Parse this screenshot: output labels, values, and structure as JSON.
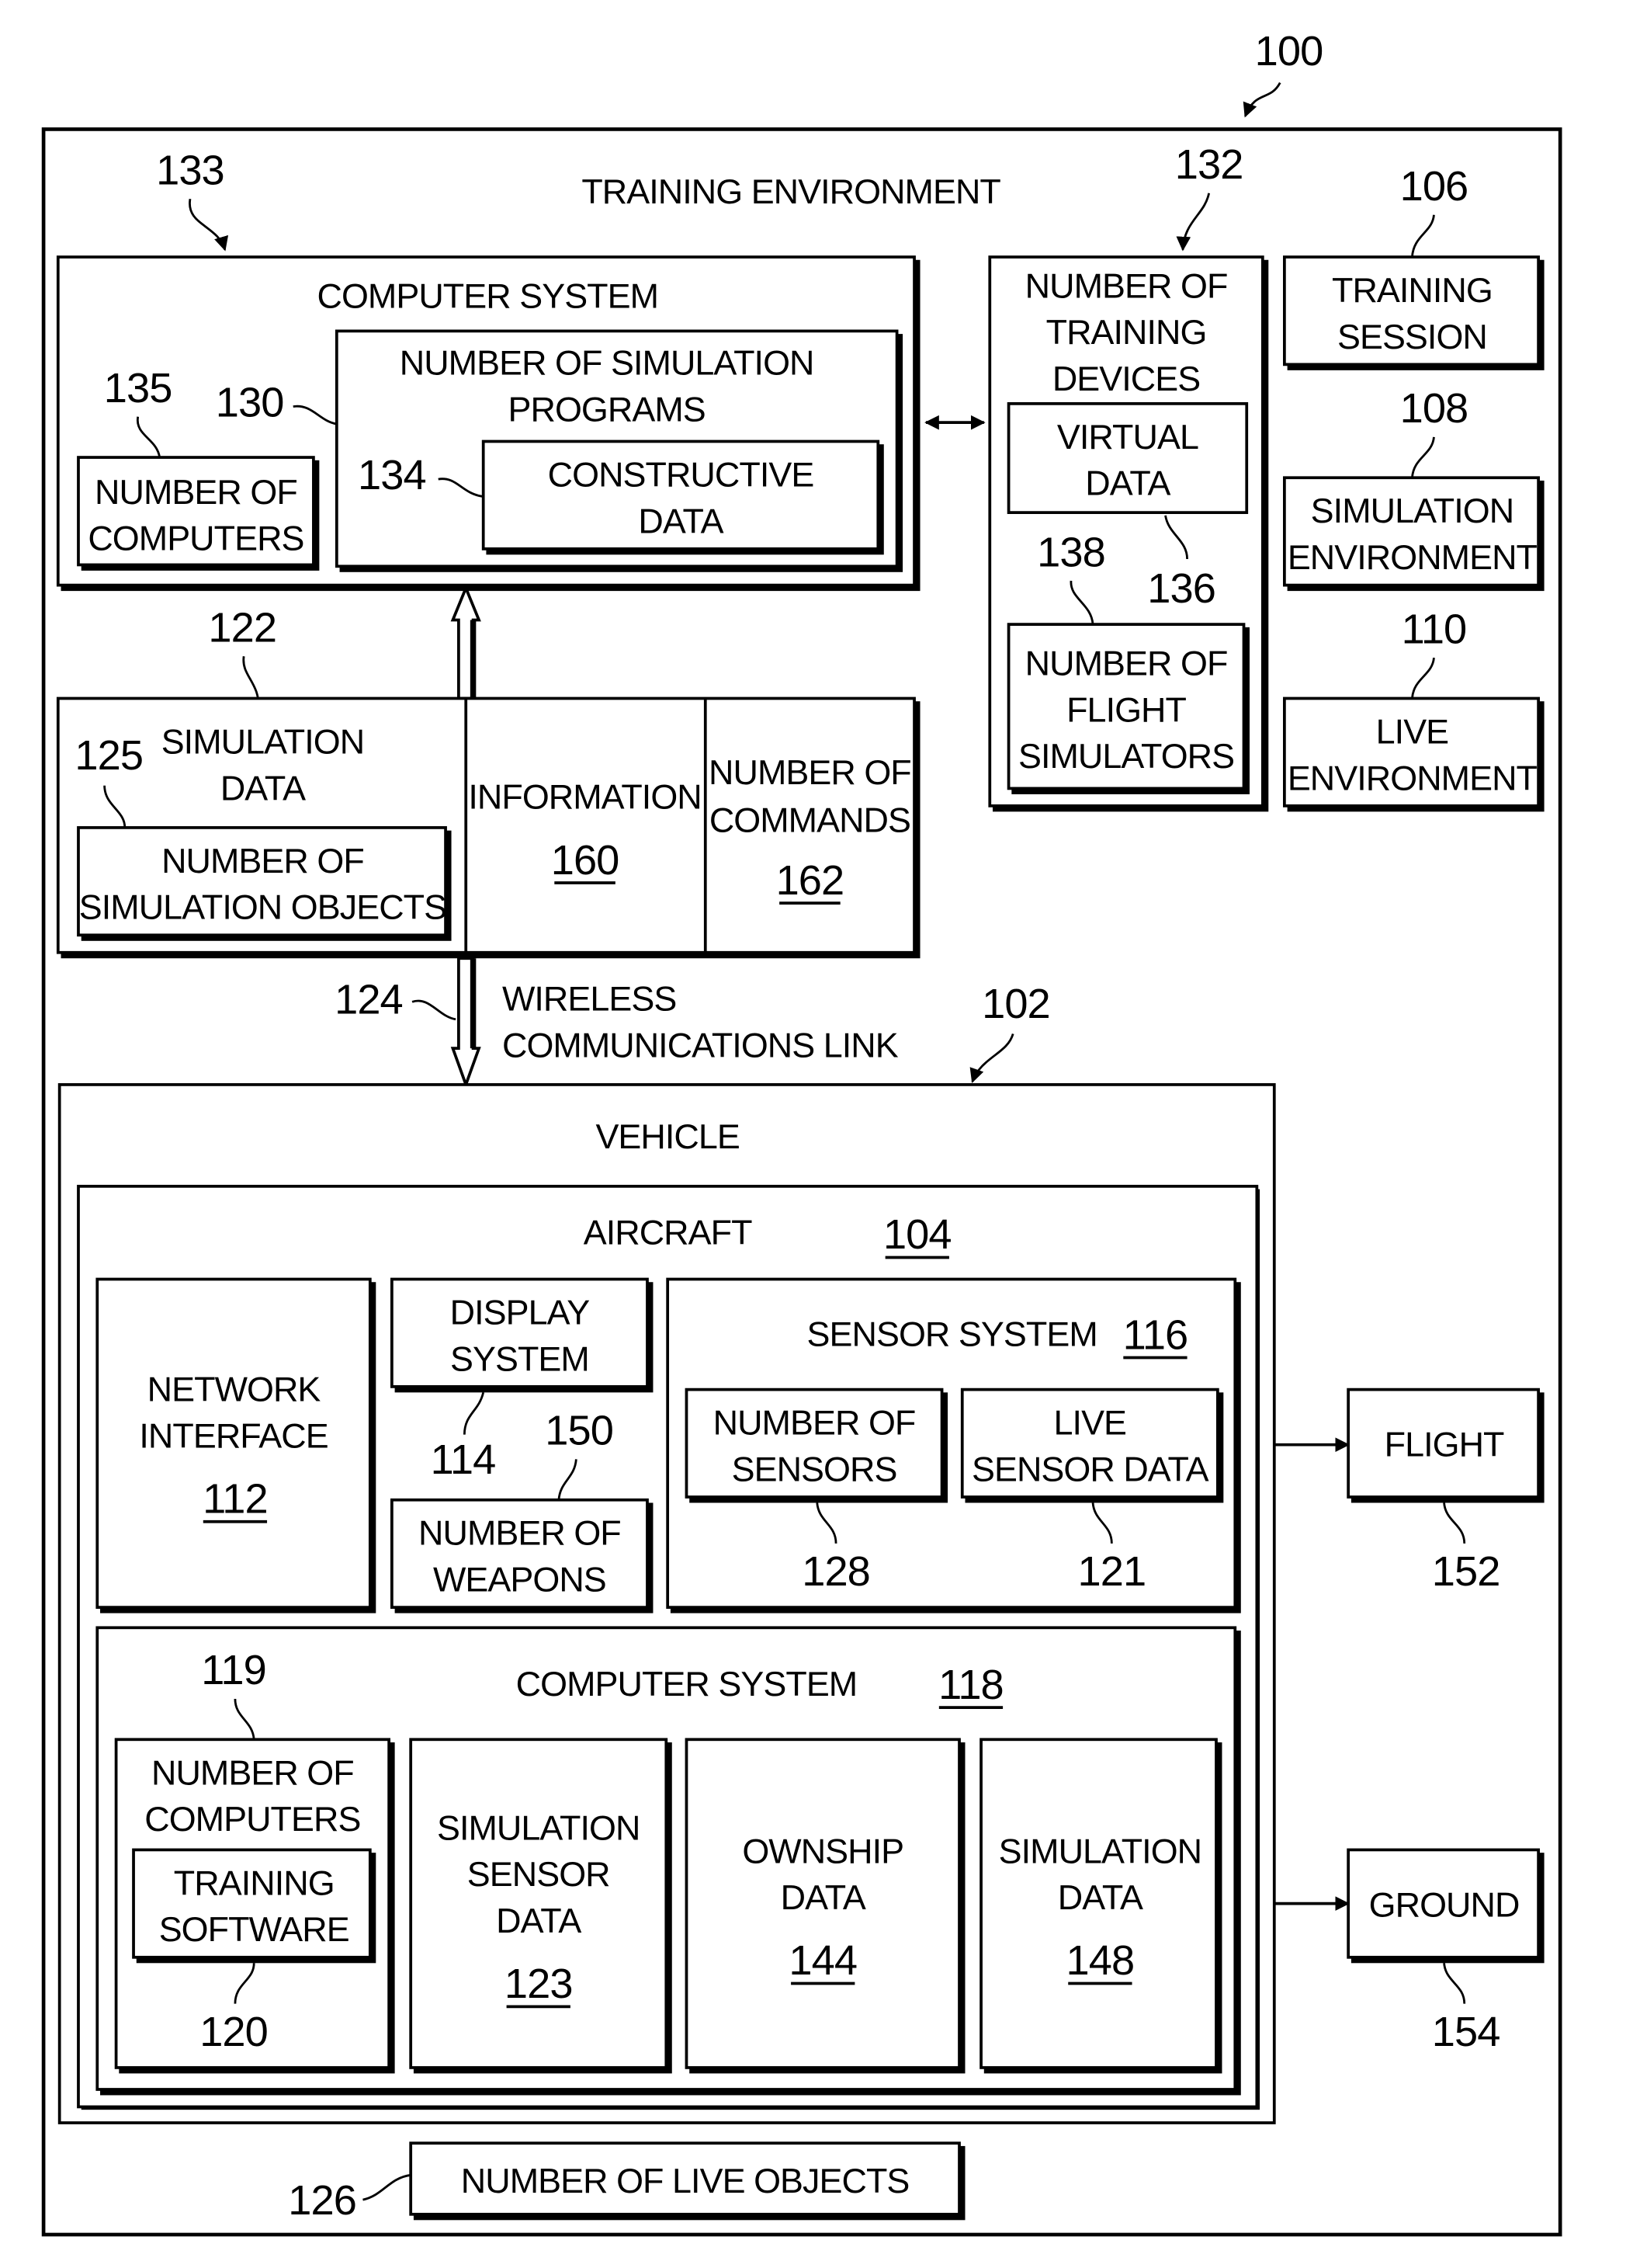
{
  "figure": {
    "ref": "100",
    "title": "TRAINING ENVIRONMENT"
  },
  "computer_system_top": {
    "ref": "133",
    "label": "COMPUTER SYSTEM",
    "computers": {
      "ref": "135",
      "lines": [
        "NUMBER OF",
        "COMPUTERS"
      ]
    },
    "programs": {
      "ref": "130",
      "lines": [
        "NUMBER OF SIMULATION",
        "PROGRAMS"
      ]
    },
    "constructive": {
      "ref": "134",
      "lines": [
        "CONSTRUCTIVE",
        "DATA"
      ]
    }
  },
  "training_devices": {
    "ref": "132",
    "lines": [
      "NUMBER OF",
      "TRAINING",
      "DEVICES"
    ],
    "virtual": {
      "ref": "136",
      "lines": [
        "VIRTUAL",
        "DATA"
      ]
    },
    "simulators": {
      "ref": "138",
      "lines": [
        "NUMBER OF",
        "FLIGHT",
        "SIMULATORS"
      ]
    }
  },
  "side_boxes": [
    {
      "ref": "106",
      "lines": [
        "TRAINING",
        "SESSION"
      ]
    },
    {
      "ref": "108",
      "lines": [
        "SIMULATION",
        "ENVIRONMENT"
      ]
    },
    {
      "ref": "110",
      "lines": [
        "LIVE",
        "ENVIRONMENT"
      ]
    }
  ],
  "data_row": {
    "simulation_data": {
      "ref": "122",
      "lines": [
        "SIMULATION",
        "DATA"
      ]
    },
    "simulation_objects": {
      "ref": "125",
      "lines": [
        "NUMBER OF",
        "SIMULATION OBJECTS"
      ]
    },
    "information": {
      "ref": "160",
      "label": "INFORMATION"
    },
    "commands": {
      "ref": "162",
      "lines": [
        "NUMBER OF",
        "COMMANDS"
      ]
    }
  },
  "link": {
    "ref": "124",
    "lines": [
      "WIRELESS",
      "COMMUNICATIONS LINK"
    ]
  },
  "vehicle": {
    "ref": "102",
    "label": "VEHICLE",
    "aircraft": {
      "ref": "104",
      "label": "AIRCRAFT"
    },
    "network": {
      "ref": "112",
      "lines": [
        "NETWORK",
        "INTERFACE"
      ]
    },
    "display": {
      "ref": "114",
      "lines": [
        "DISPLAY",
        "SYSTEM"
      ]
    },
    "weapons": {
      "ref": "150",
      "lines": [
        "NUMBER OF",
        "WEAPONS"
      ]
    },
    "sensor_system": {
      "ref": "116",
      "label": "SENSOR SYSTEM"
    },
    "sensors": {
      "ref": "128",
      "lines": [
        "NUMBER OF",
        "SENSORS"
      ]
    },
    "live_sensor": {
      "ref": "121",
      "lines": [
        "LIVE",
        "SENSOR DATA"
      ]
    },
    "computer_system": {
      "ref": "118",
      "label": "COMPUTER SYSTEM"
    },
    "computers": {
      "ref": "119",
      "lines": [
        "NUMBER OF",
        "COMPUTERS"
      ]
    },
    "training_software": {
      "ref": "120",
      "lines": [
        "TRAINING",
        "SOFTWARE"
      ]
    },
    "sim_sensor": {
      "ref": "123",
      "lines": [
        "SIMULATION",
        "SENSOR",
        "DATA"
      ]
    },
    "ownship": {
      "ref": "144",
      "lines": [
        "OWNSHIP",
        "DATA"
      ]
    },
    "sim_data": {
      "ref": "148",
      "lines": [
        "SIMULATION",
        "DATA"
      ]
    }
  },
  "flight": {
    "ref": "152",
    "label": "FLIGHT"
  },
  "ground": {
    "ref": "154",
    "label": "GROUND"
  },
  "live_objects": {
    "ref": "126",
    "label": "NUMBER OF LIVE OBJECTS"
  }
}
